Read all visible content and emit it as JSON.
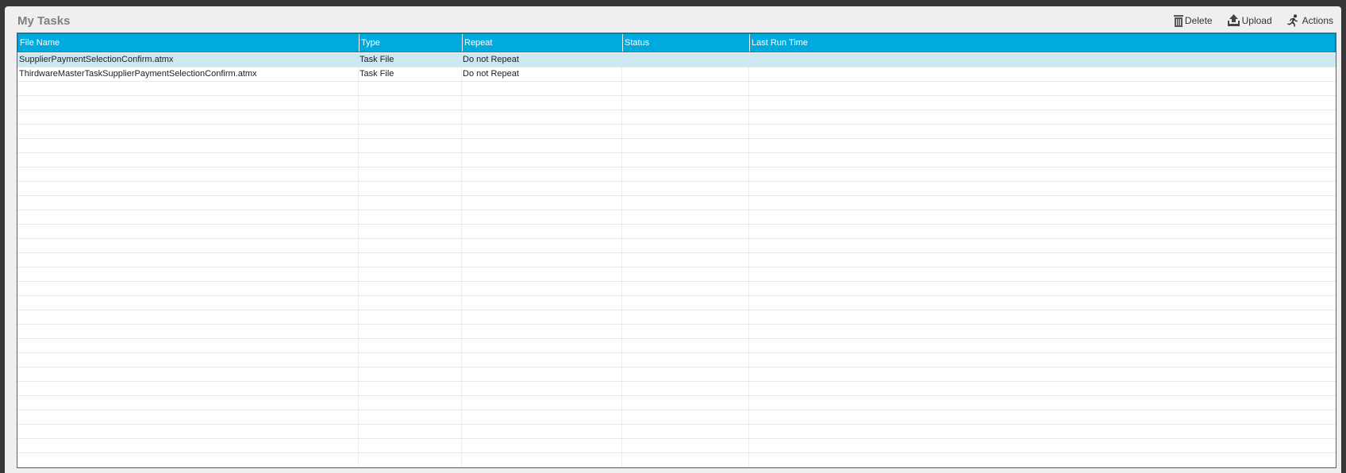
{
  "panel": {
    "title": "My Tasks"
  },
  "toolbar": {
    "delete_label": "Delete",
    "upload_label": "Upload",
    "actions_label": "Actions"
  },
  "table": {
    "columns": [
      "File Name",
      "Type",
      "Repeat",
      "Status",
      "Last Run Time"
    ],
    "rows": [
      {
        "file_name": "SupplierPaymentSelectionConfirm.atmx",
        "type": "Task File",
        "repeat": "Do not Repeat",
        "status": "",
        "last_run_time": ""
      },
      {
        "file_name": "ThirdwareMasterTaskSupplierPaymentSelectionConfirm.atmx",
        "type": "Task File",
        "repeat": "Do not Repeat",
        "status": "",
        "last_run_time": ""
      }
    ],
    "selected_row": 0
  },
  "colors": {
    "header_bg": "#00a9de",
    "selected_row_bg": "#cce8f3",
    "panel_bg": "#efefef",
    "frame_bg": "#363636"
  },
  "icons": {
    "delete": "trash-icon",
    "upload": "upload-icon",
    "actions": "running-man-icon"
  }
}
